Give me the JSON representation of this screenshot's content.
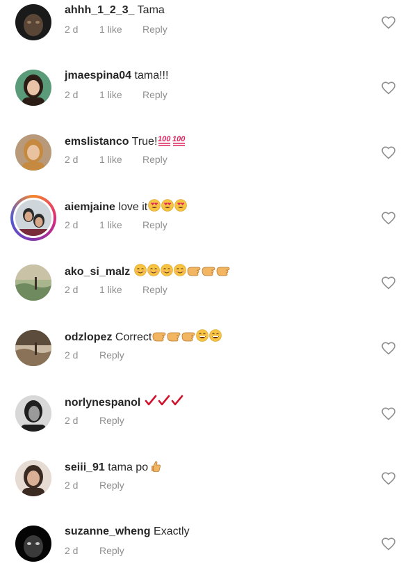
{
  "comments": [
    {
      "username": "ahhh_1_2_3_",
      "text": "Tama",
      "emojis": [],
      "age": "2 d",
      "likes": "1 like",
      "reply_label": "Reply",
      "avatar": {
        "style": "dark",
        "colors": [
          "#1a1a1a",
          "#5a4636",
          "#9b7e62"
        ]
      }
    },
    {
      "username": "jmaespina04",
      "text": "tama!!!",
      "emojis": [],
      "age": "2 d",
      "likes": "1 like",
      "reply_label": "Reply",
      "avatar": {
        "style": "person",
        "colors": [
          "#5a9c7a",
          "#2b1d16",
          "#e8c3a7"
        ]
      }
    },
    {
      "username": "emslistanco",
      "text": "True!",
      "emojis": [
        "hundred-points",
        "hundred-points"
      ],
      "age": "2 d",
      "likes": "1 like",
      "reply_label": "Reply",
      "avatar": {
        "style": "person",
        "colors": [
          "#b89a7a",
          "#c58a3f",
          "#e9c3a0"
        ]
      }
    },
    {
      "username": "aiemjaine",
      "text": "love it",
      "emojis": [
        "heart-eyes",
        "heart-eyes",
        "heart-eyes"
      ],
      "age": "2 d",
      "likes": "1 like",
      "reply_label": "Reply",
      "story_ring": true,
      "avatar": {
        "style": "couple",
        "colors": [
          "#cfd6db",
          "#2a2a2a",
          "#d7a98a"
        ]
      }
    },
    {
      "username": "ako_si_malz",
      "text": "",
      "emojis": [
        "blush",
        "blush",
        "blush",
        "blush",
        "pointing",
        "pointing",
        "pointing"
      ],
      "age": "2 d",
      "likes": "1 like",
      "reply_label": "Reply",
      "avatar": {
        "style": "landscape",
        "colors": [
          "#6f8a5f",
          "#a9b58d",
          "#c9c2a6"
        ]
      }
    },
    {
      "username": "odzlopez",
      "text": "Correct",
      "emojis": [
        "pointing",
        "pointing",
        "pointing",
        "grin",
        "grin"
      ],
      "age": "2 d",
      "likes": "",
      "reply_label": "Reply",
      "avatar": {
        "style": "landscape",
        "colors": [
          "#8a7258",
          "#c9b9a2",
          "#5b4c3c"
        ]
      }
    },
    {
      "username": "norlynespanol",
      "text": "",
      "emojis": [
        "check",
        "check",
        "check"
      ],
      "age": "2 d",
      "likes": "",
      "reply_label": "Reply",
      "avatar": {
        "style": "bw",
        "colors": [
          "#d8d8d8",
          "#1e1e1e",
          "#9a9a9a"
        ]
      }
    },
    {
      "username": "seiii_91",
      "text": "tama po",
      "emojis": [
        "thumbs-up"
      ],
      "age": "2 d",
      "likes": "",
      "reply_label": "Reply",
      "avatar": {
        "style": "person",
        "colors": [
          "#e6dcd4",
          "#3a2a22",
          "#d9b096"
        ]
      }
    },
    {
      "username": "suzanne_wheng",
      "text": "Exactly",
      "emojis": [],
      "age": "2 d",
      "likes": "",
      "reply_label": "Reply",
      "avatar": {
        "style": "dark",
        "colors": [
          "#050505",
          "#3a3a3a",
          "#c9c9c9"
        ]
      }
    }
  ],
  "icons": {
    "like": "heart-outline-icon"
  },
  "colors": {
    "text": "#262626",
    "secondary": "#8e8e8e",
    "hundred": "#e0245e",
    "check": "#d0112b",
    "emoji_face": "#f7c343"
  }
}
